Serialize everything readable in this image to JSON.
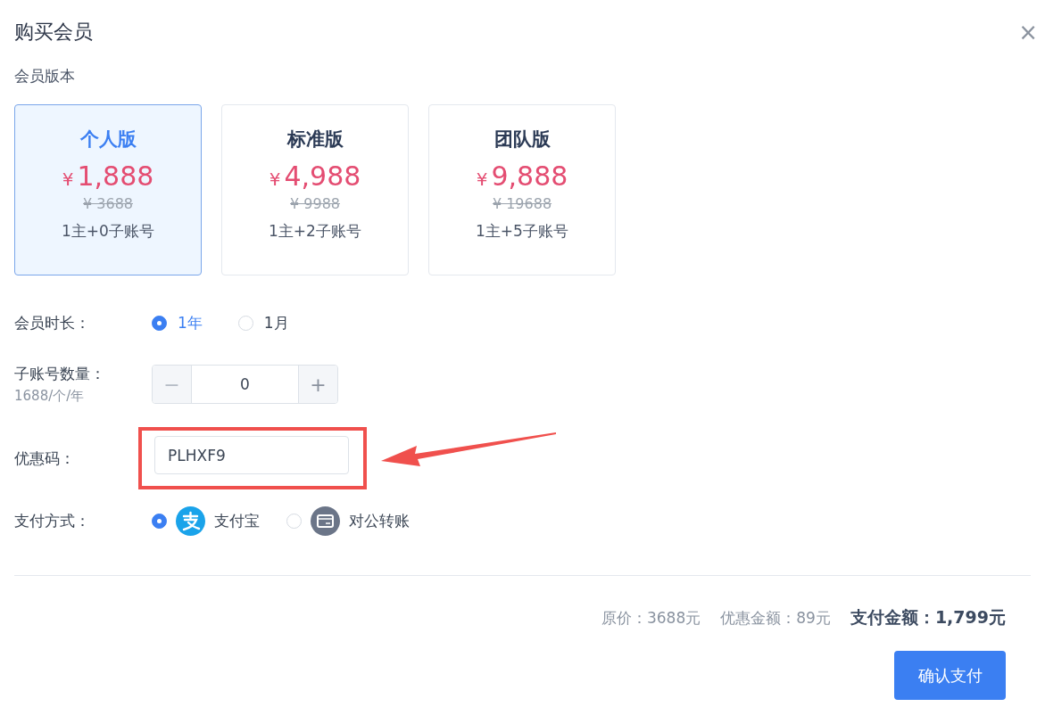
{
  "dialog": {
    "title": "购买会员",
    "close": "×"
  },
  "plans_label": "会员版本",
  "plans": [
    {
      "name": "个人版",
      "currency": "¥",
      "price": "1,888",
      "original": "¥ 3688",
      "accounts": "1主+0子账号",
      "selected": true
    },
    {
      "name": "标准版",
      "currency": "¥",
      "price": "4,988",
      "original": "¥ 9988",
      "accounts": "1主+2子账号",
      "selected": false
    },
    {
      "name": "团队版",
      "currency": "¥",
      "price": "9,888",
      "original": "¥ 19688",
      "accounts": "1主+5子账号",
      "selected": false
    }
  ],
  "duration": {
    "label": "会员时长：",
    "options": [
      {
        "label": "1年",
        "selected": true
      },
      {
        "label": "1月",
        "selected": false
      }
    ]
  },
  "sub_accounts": {
    "label": "子账号数量：",
    "hint": "1688/个/年",
    "minus": "−",
    "value": "0",
    "plus": "+"
  },
  "coupon": {
    "label": "优惠码：",
    "value": "PLHXF9",
    "highlighted": true
  },
  "payment": {
    "label": "支付方式：",
    "options": [
      {
        "kind": "alipay",
        "label": "支付宝",
        "selected": true
      },
      {
        "kind": "bank",
        "label": "对公转账",
        "selected": false
      }
    ]
  },
  "summary": {
    "original": "原价：3688元",
    "discount": "优惠金额：89元",
    "total": "支付金额：1,799元"
  },
  "confirm_button": "确认支付"
}
